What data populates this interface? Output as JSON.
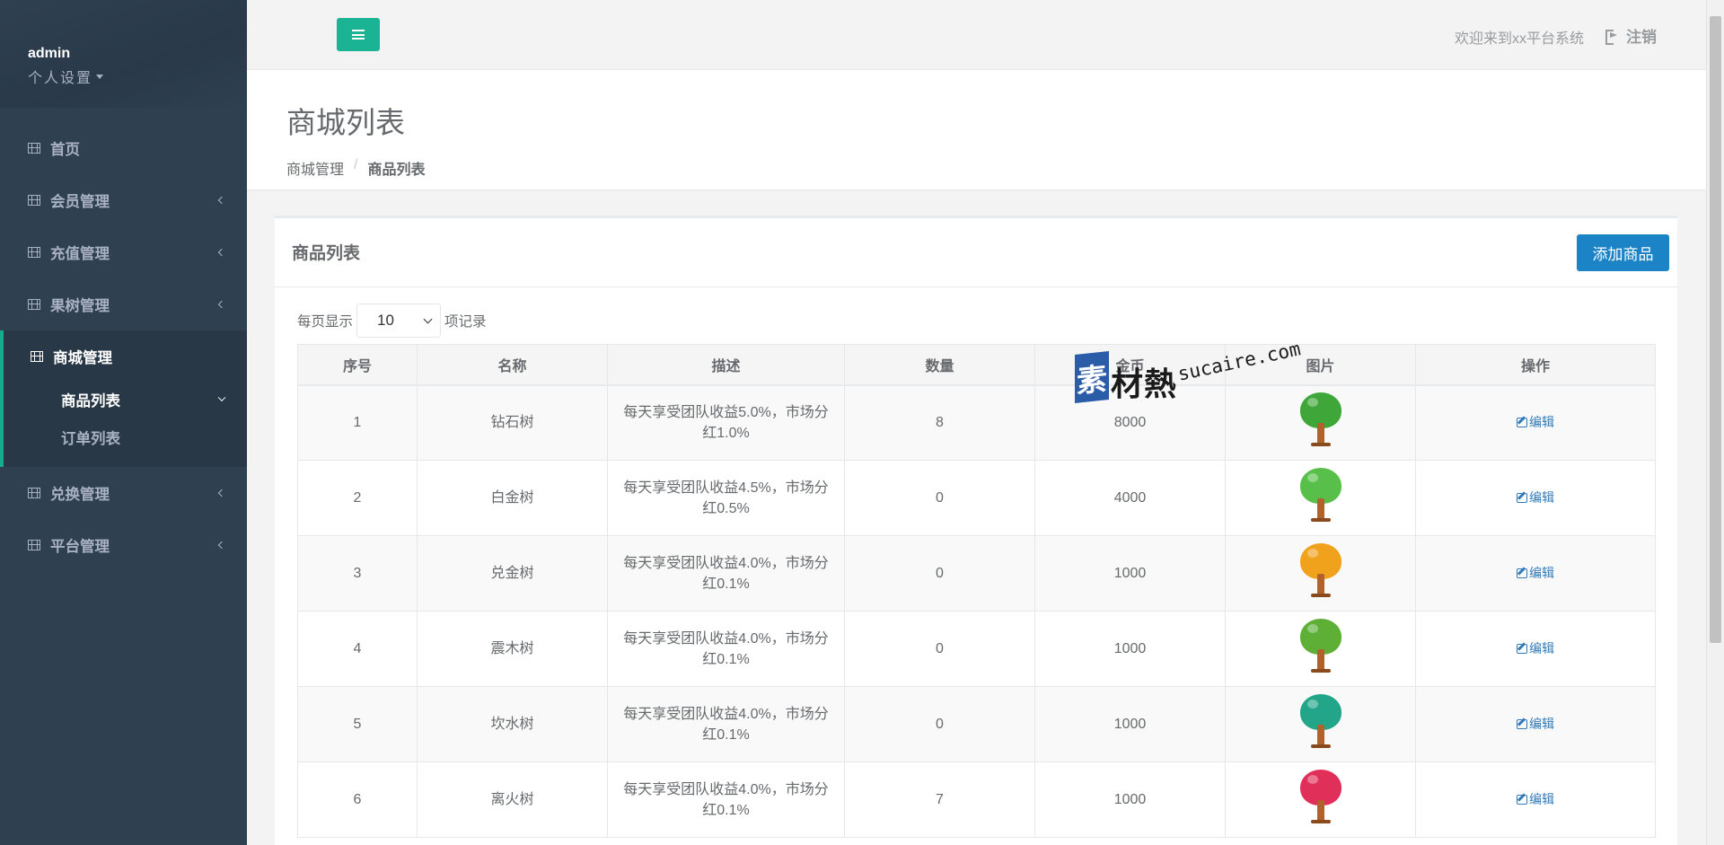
{
  "sidebar": {
    "username": "admin",
    "settings_label": "个人设置",
    "items": [
      {
        "label": "首页",
        "has_chevron": false
      },
      {
        "label": "会员管理",
        "has_chevron": true
      },
      {
        "label": "充值管理",
        "has_chevron": true
      },
      {
        "label": "果树管理",
        "has_chevron": true
      }
    ],
    "active_group": {
      "label": "商城管理",
      "subitems": [
        {
          "label": "商品列表",
          "active": true
        },
        {
          "label": "订单列表",
          "active": false
        }
      ]
    },
    "items_after": [
      {
        "label": "兑换管理",
        "has_chevron": true
      },
      {
        "label": "平台管理",
        "has_chevron": true
      }
    ]
  },
  "topbar": {
    "welcome_text": "欢迎来到xx平台系统",
    "logout_label": "注销"
  },
  "heading": {
    "title": "商城列表",
    "breadcrumb": [
      "商城管理",
      "商品列表"
    ]
  },
  "panel": {
    "title": "商品列表",
    "add_button": "添加商品",
    "length_prefix": "每页显示",
    "length_value": "10",
    "length_suffix": "项记录"
  },
  "table": {
    "columns": [
      "序号",
      "名称",
      "描述",
      "数量",
      "金币",
      "图片",
      "操作"
    ],
    "edit_label": "编辑",
    "rows": [
      {
        "id": "1",
        "name": "钻石树",
        "desc": "每天享受团队收益5.0%，市场分红1.0%",
        "qty": "8",
        "gold": "8000",
        "tree_color": "#3fa63a"
      },
      {
        "id": "2",
        "name": "白金树",
        "desc": "每天享受团队收益4.5%，市场分红0.5%",
        "qty": "0",
        "gold": "4000",
        "tree_color": "#58c04a"
      },
      {
        "id": "3",
        "name": "兑金树",
        "desc": "每天享受团队收益4.0%，市场分红0.1%",
        "qty": "0",
        "gold": "1000",
        "tree_color": "#f0a21c"
      },
      {
        "id": "4",
        "name": "震木树",
        "desc": "每天享受团队收益4.0%，市场分红0.1%",
        "qty": "0",
        "gold": "1000",
        "tree_color": "#5daf36"
      },
      {
        "id": "5",
        "name": "坎水树",
        "desc": "每天享受团队收益4.0%，市场分红0.1%",
        "qty": "0",
        "gold": "1000",
        "tree_color": "#23a589"
      },
      {
        "id": "6",
        "name": "离火树",
        "desc": "每天享受团队收益4.0%，市场分红0.1%",
        "qty": "7",
        "gold": "1000",
        "tree_color": "#e0305a"
      }
    ]
  },
  "watermark": {
    "box_char": "素",
    "cn_text": "材熱",
    "en_text": "sucaire.com"
  },
  "colors": {
    "sidebar_bg": "#2f4050",
    "accent_green": "#1ab394",
    "primary_blue": "#1c84c6",
    "link_blue": "#337ab7"
  }
}
